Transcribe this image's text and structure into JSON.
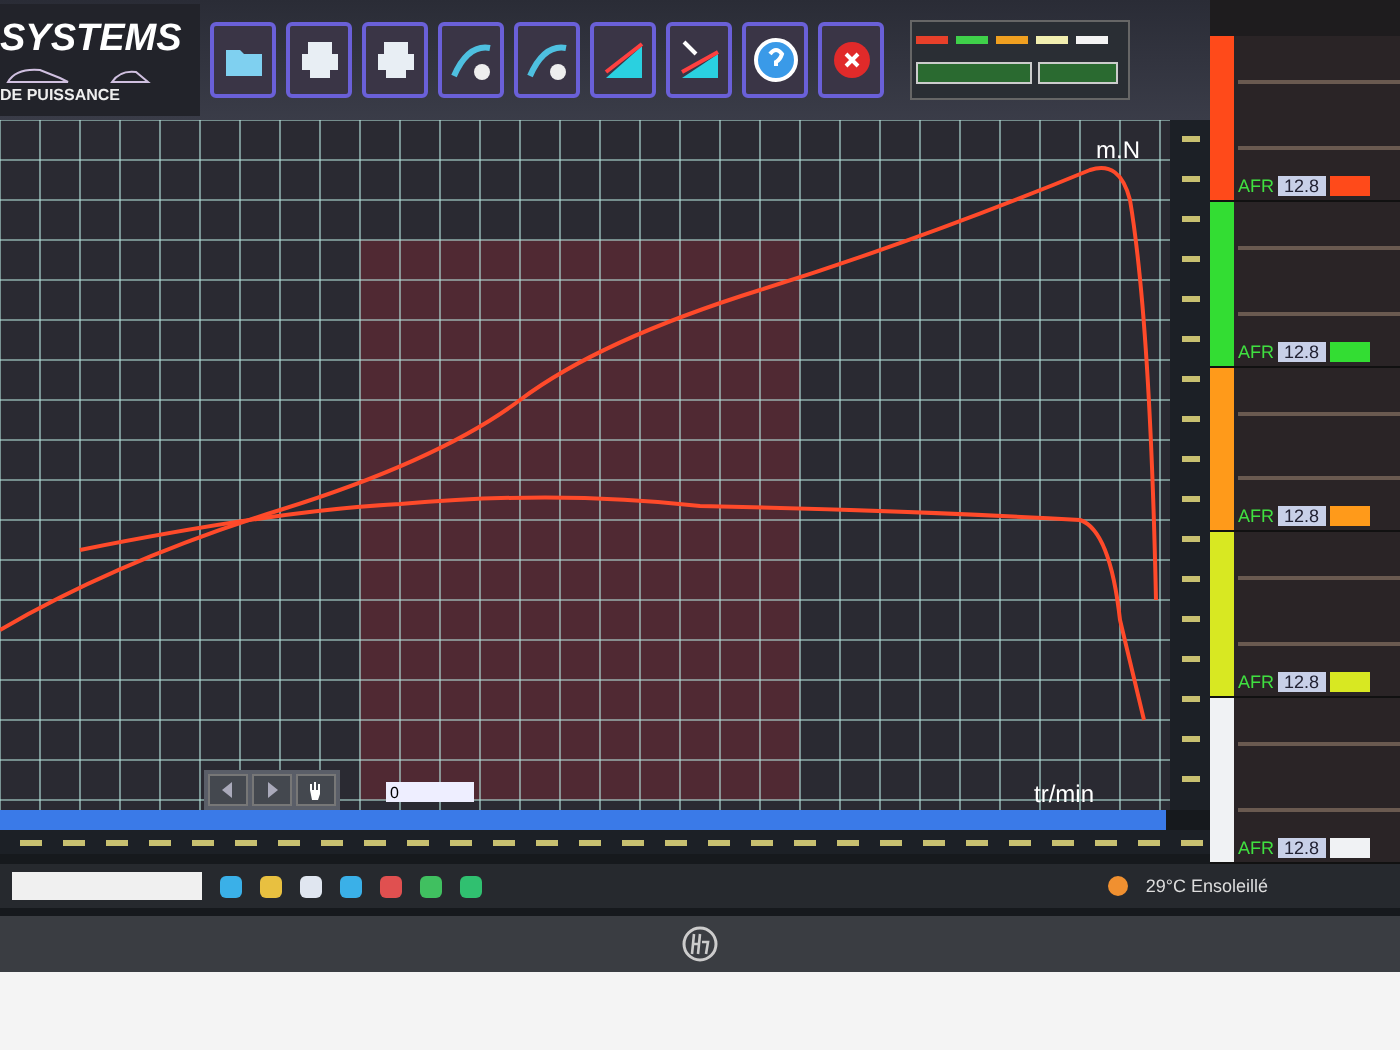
{
  "logo": {
    "title": "SYSTEMS",
    "subtitle": "DE PUISSANCE"
  },
  "channel_swatches": [
    {
      "color": "#e8402a"
    },
    {
      "color": "#3fd14a"
    },
    {
      "color": "#f0a020"
    },
    {
      "color": "#f2efb0"
    },
    {
      "color": "#f4f4f4"
    }
  ],
  "chart": {
    "y_unit": "m.N",
    "x_unit": "tr/min"
  },
  "chart_field": {
    "value": "0"
  },
  "panels": [
    {
      "color": "#ff4a1a",
      "afr_label": "AFR",
      "afr_value": "12.8"
    },
    {
      "color": "#33dd33",
      "afr_label": "AFR",
      "afr_value": "12.8"
    },
    {
      "color": "#ff9a1a",
      "afr_label": "AFR",
      "afr_value": "12.8"
    },
    {
      "color": "#d8e822",
      "afr_label": "AFR",
      "afr_value": "12.8"
    },
    {
      "color": "#f0f2f4",
      "afr_label": "AFR",
      "afr_value": "12.8"
    }
  ],
  "taskbar": {
    "weather": "29°C Ensoleillé"
  }
}
